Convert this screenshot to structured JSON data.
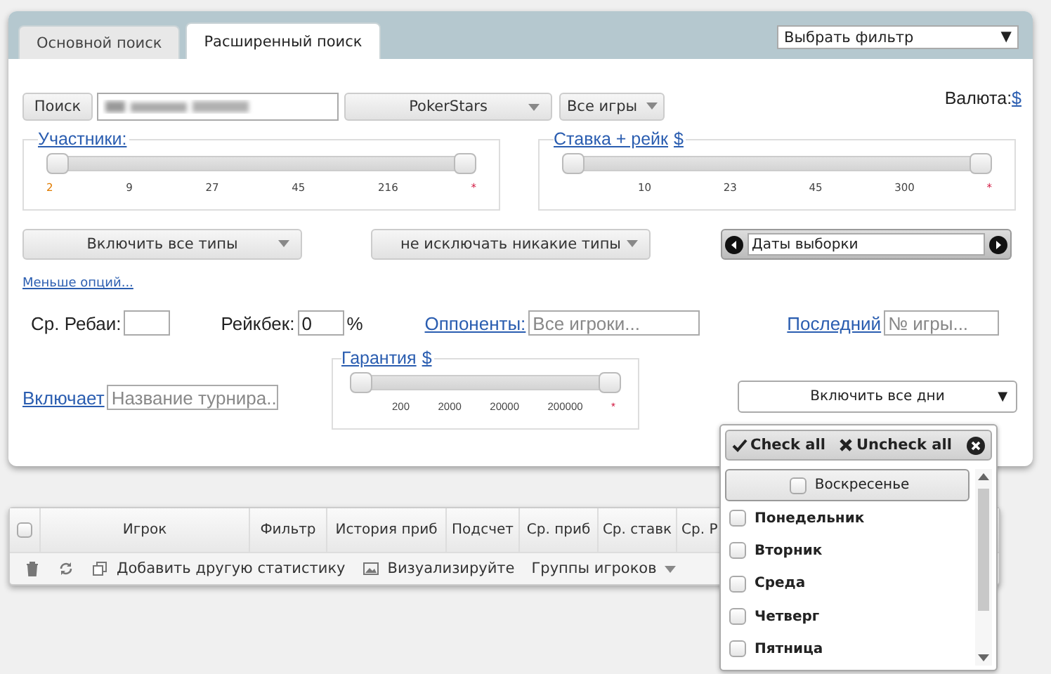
{
  "header": {
    "tabs": [
      {
        "label": "Основной поиск",
        "selected": false
      },
      {
        "label": "Расширенный поиск",
        "selected": true
      }
    ],
    "filter_select": {
      "value": "Выбрать фильтр",
      "arrow": "▼"
    }
  },
  "search_bar": {
    "button": "Поиск",
    "site_select": "PokerStars",
    "games_select": "Все игры",
    "currency_label": "Валюта:",
    "currency_link": "$"
  },
  "sliders": [
    {
      "title": "Участники:",
      "thumbs": [
        {
          "level": 0
        },
        {
          "level": 1
        }
      ],
      "ticks": [
        {
          "label": "2",
          "kind": "current"
        },
        {
          "label": "9",
          "kind": "plain"
        },
        {
          "label": "27",
          "kind": "plain"
        },
        {
          "label": "45",
          "kind": "plain"
        },
        {
          "label": "216",
          "kind": "plain"
        },
        {
          "label": "*",
          "kind": "max"
        }
      ]
    },
    {
      "title": "Ставка + рейк",
      "unit": "$",
      "thumbs": [
        {
          "level": 0
        },
        {
          "level": 1
        }
      ],
      "ticks": [
        {
          "label": "10",
          "kind": "plain"
        },
        {
          "label": "23",
          "kind": "plain"
        },
        {
          "label": "45",
          "kind": "plain"
        },
        {
          "label": "300",
          "kind": "plain"
        },
        {
          "label": "*",
          "kind": "max"
        }
      ]
    }
  ],
  "type_selects": [
    {
      "value": "Включить все типы"
    },
    {
      "value": "не исключать никакие типы"
    }
  ],
  "date_range": {
    "value": "Даты выборки"
  },
  "less_options": "Меньше опций...",
  "fields": [
    {
      "kind": "text",
      "label": "Ср. Ребаи:"
    },
    {
      "kind": "text",
      "label": "Рейкбек:",
      "value": "0",
      "suffix": "%"
    },
    {
      "kind": "link",
      "label": "Оппоненты:",
      "placeholder": "Все игроки..."
    },
    {
      "kind": "link",
      "label": "Последний",
      "placeholder": "№ игры..."
    }
  ],
  "includes": {
    "label": "Включает",
    "placeholder": "Название турнира.."
  },
  "guarantee": {
    "title": "Гарантия",
    "unit": "$",
    "thumbs": [
      {
        "level": 0
      },
      {
        "level": 1
      }
    ],
    "ticks": [
      {
        "label": "200",
        "kind": "plain"
      },
      {
        "label": "2000",
        "kind": "plain"
      },
      {
        "label": "20000",
        "kind": "plain"
      },
      {
        "label": "200000",
        "kind": "plain"
      },
      {
        "label": "*",
        "kind": "max"
      }
    ]
  },
  "days_select": {
    "value": "Включить все дни",
    "arrow": "▼"
  },
  "days_menu": {
    "check_all": "Check all",
    "uncheck_all": "Uncheck all",
    "items": [
      {
        "label": "Воскресенье",
        "checked": false,
        "selected": true
      },
      {
        "label": "Понедельник",
        "checked": false,
        "selected": false
      },
      {
        "label": "Вторник",
        "checked": false,
        "selected": false
      },
      {
        "label": "Среда",
        "checked": false,
        "selected": false
      },
      {
        "label": "Четверг",
        "checked": false,
        "selected": false
      },
      {
        "label": "Пятница",
        "checked": false,
        "selected": false
      }
    ]
  },
  "table": {
    "select_all": {
      "checked": false
    },
    "columns": [
      "Игрок",
      "Фильтр",
      "История приб",
      "Подсчет",
      "Ср. приб",
      "Ср. ставк",
      "Ср. Р"
    ],
    "toolbar": [
      {
        "kind": "delete"
      },
      {
        "kind": "refresh"
      },
      {
        "kind": "add",
        "label": "Добавить другую статистику"
      },
      {
        "kind": "chart",
        "label": "Визуализируйте"
      },
      {
        "kind": "menu",
        "label": "Группы игроков"
      }
    ]
  }
}
